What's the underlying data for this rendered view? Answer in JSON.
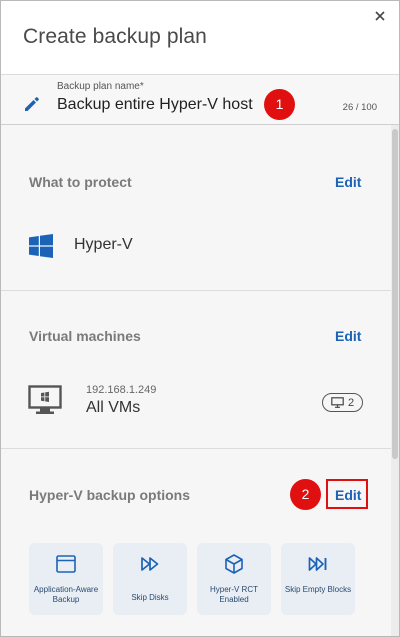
{
  "dialog": {
    "title": "Create backup plan",
    "close_icon": "close-icon"
  },
  "plan_name": {
    "label": "Backup plan name*",
    "value": "Backup entire Hyper-V host",
    "counter": "26 / 100",
    "icon": "pencil-icon"
  },
  "annotations": {
    "badge1": "1",
    "badge2": "2",
    "badge_color": "#e01010"
  },
  "what_to_protect": {
    "title": "What to protect",
    "edit_label": "Edit",
    "item_label": "Hyper-V",
    "icon": "windows-logo-icon"
  },
  "virtual_machines": {
    "title": "Virtual machines",
    "edit_label": "Edit",
    "host_ip": "192.168.1.249",
    "selection": "All VMs",
    "vm_count": "2",
    "icon": "monitor-icon"
  },
  "backup_options": {
    "title": "Hyper-V backup options",
    "edit_label": "Edit",
    "tiles": [
      {
        "label": "Application-Aware Backup",
        "icon": "window-icon"
      },
      {
        "label": "Skip Disks",
        "icon": "fast-forward-icon"
      },
      {
        "label": "Hyper-V RCT Enabled",
        "icon": "cube-icon"
      },
      {
        "label": "Skip Empty Blocks",
        "icon": "skip-forward-icon"
      }
    ]
  },
  "colors": {
    "accent": "#1c63b7",
    "tile_bg": "#e8eef3",
    "highlight": "#e01010"
  }
}
